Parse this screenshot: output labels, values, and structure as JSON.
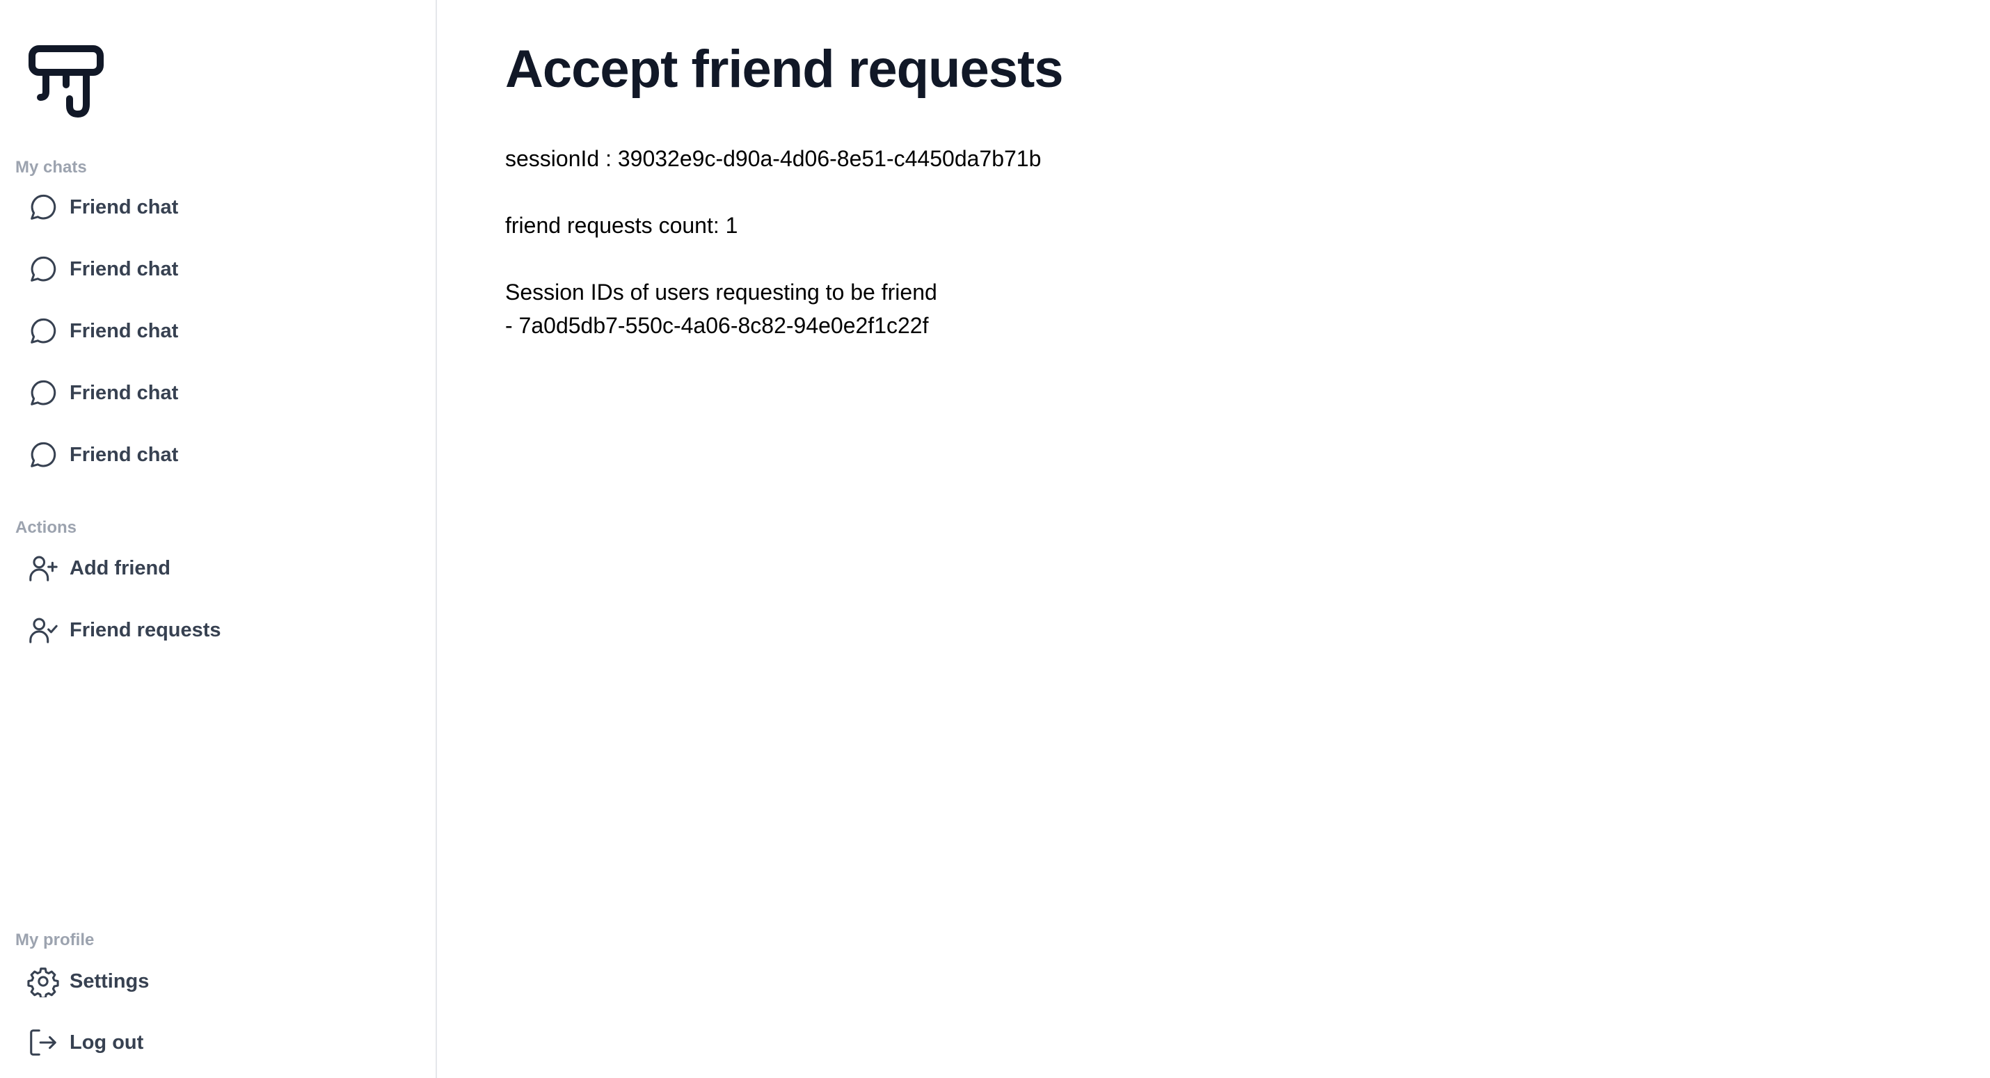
{
  "sidebar": {
    "my_chats_label": "My chats",
    "chats": [
      {
        "label": "Friend chat",
        "icon": "chat-bubble-icon"
      },
      {
        "label": "Friend chat",
        "icon": "chat-bubble-icon"
      },
      {
        "label": "Friend chat",
        "icon": "chat-bubble-icon"
      },
      {
        "label": "Friend chat",
        "icon": "chat-bubble-icon"
      },
      {
        "label": "Friend chat",
        "icon": "chat-bubble-icon"
      }
    ],
    "actions_label": "Actions",
    "actions": [
      {
        "label": "Add friend",
        "icon": "user-plus-icon"
      },
      {
        "label": "Friend requests",
        "icon": "user-check-icon"
      }
    ],
    "profile_label": "My profile",
    "profile": [
      {
        "label": "Settings",
        "icon": "gear-icon"
      },
      {
        "label": "Log out",
        "icon": "logout-icon"
      }
    ]
  },
  "main": {
    "title": "Accept friend requests",
    "session_line": "sessionId : 39032e9c-d90a-4d06-8e51-c4450da7b71b",
    "count_line": "friend requests count: 1",
    "requesters_heading": "Session IDs of users requesting to be friend",
    "requesters": [
      "- 7a0d5db7-550c-4a06-8c82-94e0e2f1c22f"
    ]
  },
  "colors": {
    "text_primary": "#111827",
    "nav_text": "#374151",
    "section_label": "#9ca3af",
    "divider": "#e5e7eb"
  }
}
